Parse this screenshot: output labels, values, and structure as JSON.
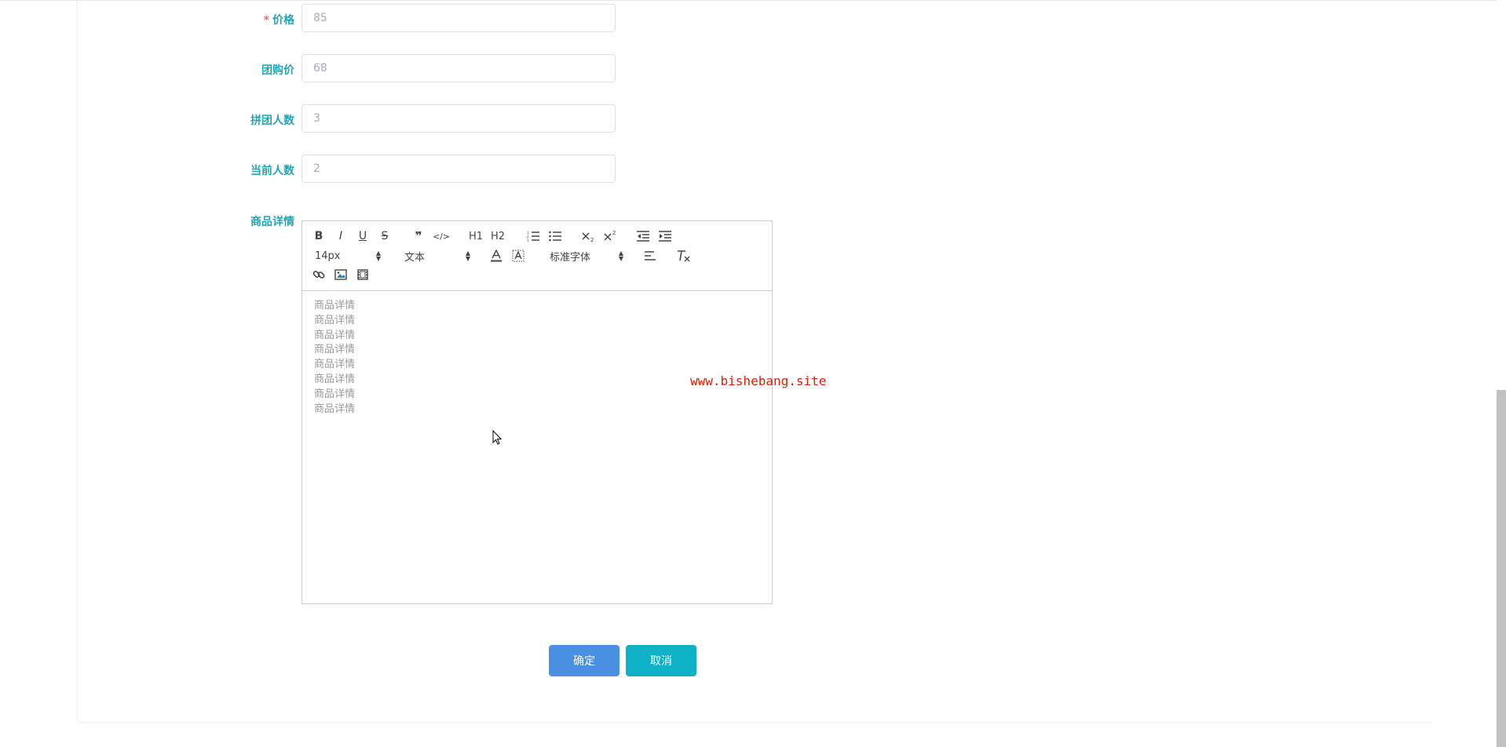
{
  "form": {
    "price": {
      "label": "价格",
      "required_mark": "*",
      "value": "85"
    },
    "group_price": {
      "label": "团购价",
      "value": "68"
    },
    "group_size": {
      "label": "拼团人数",
      "value": "3"
    },
    "current_count": {
      "label": "当前人数",
      "value": "2"
    },
    "details": {
      "label": "商品详情"
    }
  },
  "editor": {
    "toolbar": {
      "bold": "B",
      "italic": "I",
      "underline": "U",
      "strike": "S",
      "quote": "❞",
      "code": "</>",
      "h1": "H1",
      "h2": "H2",
      "size": "14px",
      "header": "文本",
      "font": "标准字体"
    },
    "content_lines": [
      "商品详情",
      "商品详情",
      "商品详情",
      "商品详情",
      "商品详情",
      "商品详情",
      "商品详情",
      "商品详情"
    ]
  },
  "watermark": "www.bishebang.site",
  "buttons": {
    "confirm": "确定",
    "cancel": "取消"
  },
  "colors": {
    "label": "#22a6b3",
    "required": "#f56c6c",
    "confirm_bg": "#4a90e2",
    "cancel_bg": "#0fb1c6",
    "watermark": "#d81e06"
  }
}
